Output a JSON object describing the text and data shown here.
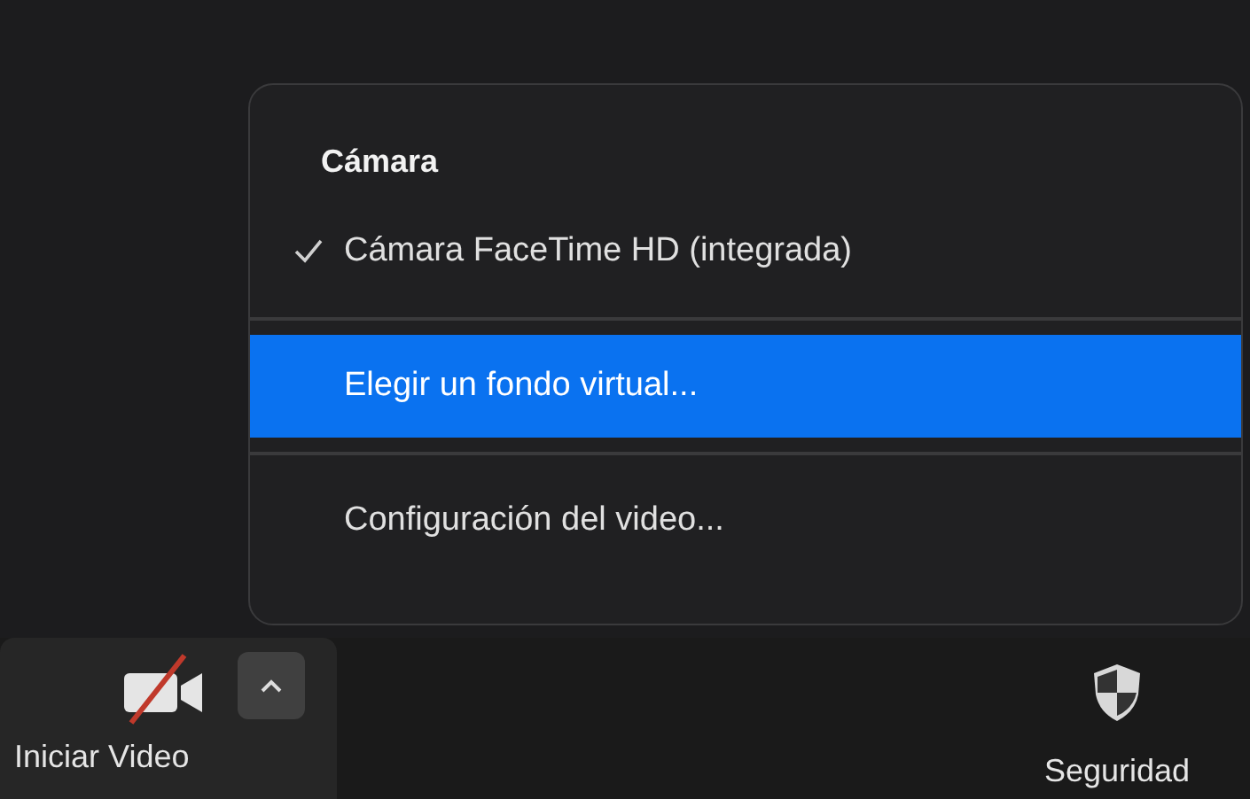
{
  "menu": {
    "header": "Cámara",
    "items": [
      {
        "label": "Cámara FaceTime HD (integrada)",
        "checked": true,
        "selected": false
      },
      {
        "label": "Elegir un fondo virtual...",
        "checked": false,
        "selected": true
      },
      {
        "label": "Configuración del video...",
        "checked": false,
        "selected": false
      }
    ]
  },
  "toolbar": [
    {
      "kind": "video",
      "label": "Iniciar Video",
      "video_on": false
    },
    {
      "kind": "security",
      "label": "Seguridad"
    }
  ]
}
